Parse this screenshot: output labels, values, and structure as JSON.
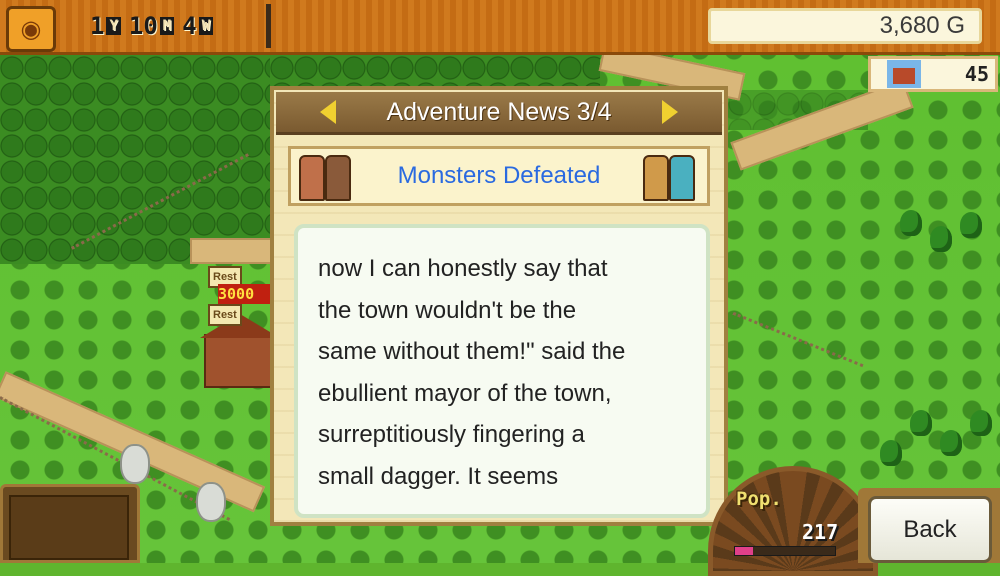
{
  "top_bar": {
    "date_year": "1",
    "date_year_unit": "Y",
    "date_month": "10",
    "date_month_unit": "M",
    "date_week": "4",
    "date_week_unit": "W",
    "gold": "3,680 G",
    "town_rank": "45"
  },
  "map": {
    "worker_tag_1": "Rest",
    "worker_tag_2": "Rest",
    "money_popup": "3000"
  },
  "dialog": {
    "title": "Adventure News 3/4",
    "category": "Monsters Defeated",
    "body": "now I can honestly say that\nthe town wouldn't be the\nsame without them!\" said the\nebullient mayor of the town,\nsurreptitiously fingering a\nsmall dagger. It seems"
  },
  "bottom": {
    "pop_label": "Pop.",
    "pop_value": "217",
    "pop_fill_fraction": 0.18,
    "back_label": "Back"
  },
  "colors": {
    "category_text": "#2a6ae0",
    "arrow": "#f0d030",
    "top_bar": "#d07a1e"
  },
  "icons": [
    "pumpkin-icon",
    "arrow-left-icon",
    "arrow-right-icon",
    "house-icon"
  ]
}
